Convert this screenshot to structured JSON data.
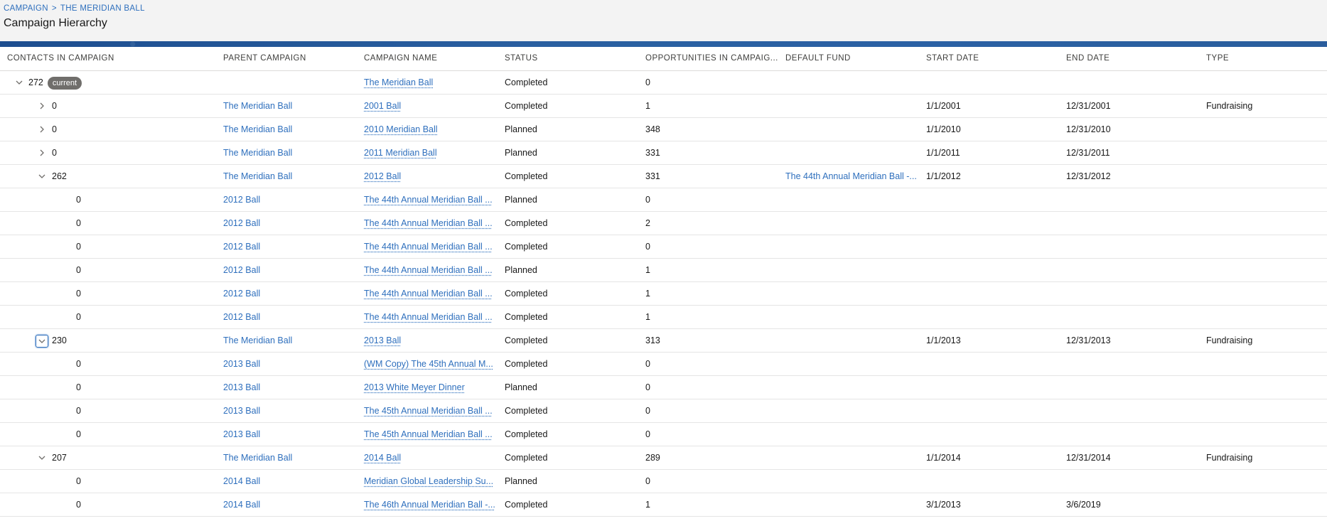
{
  "breadcrumb": {
    "campaign": "CAMPAIGN",
    "separator": ">",
    "current": "THE MERIDIAN BALL"
  },
  "page_title": "Campaign Hierarchy",
  "columns": [
    "CONTACTS IN CAMPAIGN",
    "PARENT CAMPAIGN",
    "CAMPAIGN NAME",
    "STATUS",
    "OPPORTUNITIES IN CAMPAIG...",
    "DEFAULT FUND",
    "START DATE",
    "END DATE",
    "TYPE"
  ],
  "current_badge": "current",
  "rows": [
    {
      "toggle": "down",
      "contacts": "272",
      "parent": "",
      "name": "The Meridian Ball",
      "status": "Completed",
      "opps": "0",
      "fund": "",
      "start": "",
      "end": "",
      "type": ""
    },
    {
      "toggle": "right",
      "contacts": "0",
      "parent": "The Meridian Ball",
      "name": "2001 Ball",
      "status": "Completed",
      "opps": "1",
      "fund": "",
      "start": "1/1/2001",
      "end": "12/31/2001",
      "type": "Fundraising"
    },
    {
      "toggle": "right",
      "contacts": "0",
      "parent": "The Meridian Ball",
      "name": "2010 Meridian Ball",
      "status": "Planned",
      "opps": "348",
      "fund": "",
      "start": "1/1/2010",
      "end": "12/31/2010",
      "type": ""
    },
    {
      "toggle": "right",
      "contacts": "0",
      "parent": "The Meridian Ball",
      "name": "2011 Meridian Ball",
      "status": "Planned",
      "opps": "331",
      "fund": "",
      "start": "1/1/2011",
      "end": "12/31/2011",
      "type": ""
    },
    {
      "toggle": "down",
      "contacts": "262",
      "parent": "The Meridian Ball",
      "name": "2012 Ball",
      "status": "Completed",
      "opps": "331",
      "fund": "The 44th Annual Meridian Ball -...",
      "start": "1/1/2012",
      "end": "12/31/2012",
      "type": ""
    },
    {
      "toggle": "",
      "contacts": "0",
      "parent": "2012 Ball",
      "name": "The 44th Annual Meridian Ball ...",
      "status": "Planned",
      "opps": "0",
      "fund": "",
      "start": "",
      "end": "",
      "type": ""
    },
    {
      "toggle": "",
      "contacts": "0",
      "parent": "2012 Ball",
      "name": "The 44th Annual Meridian Ball ...",
      "status": "Completed",
      "opps": "2",
      "fund": "",
      "start": "",
      "end": "",
      "type": ""
    },
    {
      "toggle": "",
      "contacts": "0",
      "parent": "2012 Ball",
      "name": "The 44th Annual Meridian Ball ...",
      "status": "Completed",
      "opps": "0",
      "fund": "",
      "start": "",
      "end": "",
      "type": ""
    },
    {
      "toggle": "",
      "contacts": "0",
      "parent": "2012 Ball",
      "name": "The 44th Annual Meridian Ball ...",
      "status": "Planned",
      "opps": "1",
      "fund": "",
      "start": "",
      "end": "",
      "type": ""
    },
    {
      "toggle": "",
      "contacts": "0",
      "parent": "2012 Ball",
      "name": "The 44th Annual Meridian Ball ...",
      "status": "Completed",
      "opps": "1",
      "fund": "",
      "start": "",
      "end": "",
      "type": ""
    },
    {
      "toggle": "",
      "contacts": "0",
      "parent": "2012 Ball",
      "name": "The 44th Annual Meridian Ball ...",
      "status": "Completed",
      "opps": "1",
      "fund": "",
      "start": "",
      "end": "",
      "type": ""
    },
    {
      "toggle": "down-focused",
      "contacts": "230",
      "parent": "The Meridian Ball",
      "name": "2013 Ball",
      "status": "Completed",
      "opps": "313",
      "fund": "",
      "start": "1/1/2013",
      "end": "12/31/2013",
      "type": "Fundraising"
    },
    {
      "toggle": "",
      "contacts": "0",
      "parent": "2013 Ball",
      "name": "(WM Copy) The 45th Annual M...",
      "status": "Completed",
      "opps": "0",
      "fund": "",
      "start": "",
      "end": "",
      "type": ""
    },
    {
      "toggle": "",
      "contacts": "0",
      "parent": "2013 Ball",
      "name": "2013 White Meyer Dinner",
      "status": "Planned",
      "opps": "0",
      "fund": "",
      "start": "",
      "end": "",
      "type": ""
    },
    {
      "toggle": "",
      "contacts": "0",
      "parent": "2013 Ball",
      "name": "The 45th Annual Meridian Ball ...",
      "status": "Completed",
      "opps": "0",
      "fund": "",
      "start": "",
      "end": "",
      "type": ""
    },
    {
      "toggle": "",
      "contacts": "0",
      "parent": "2013 Ball",
      "name": "The 45th Annual Meridian Ball ...",
      "status": "Completed",
      "opps": "0",
      "fund": "",
      "start": "",
      "end": "",
      "type": ""
    },
    {
      "toggle": "down",
      "contacts": "207",
      "parent": "The Meridian Ball",
      "name": "2014 Ball",
      "status": "Completed",
      "opps": "289",
      "fund": "",
      "start": "1/1/2014",
      "end": "12/31/2014",
      "type": "Fundraising"
    },
    {
      "toggle": "",
      "contacts": "0",
      "parent": "2014 Ball",
      "name": "Meridian Global Leadership Su...",
      "status": "Planned",
      "opps": "0",
      "fund": "",
      "start": "",
      "end": "",
      "type": ""
    },
    {
      "toggle": "",
      "contacts": "0",
      "parent": "2014 Ball",
      "name": "The 46th Annual Meridian Ball -...",
      "status": "Completed",
      "opps": "1",
      "fund": "",
      "start": "3/1/2013",
      "end": "3/6/2019",
      "type": ""
    }
  ]
}
